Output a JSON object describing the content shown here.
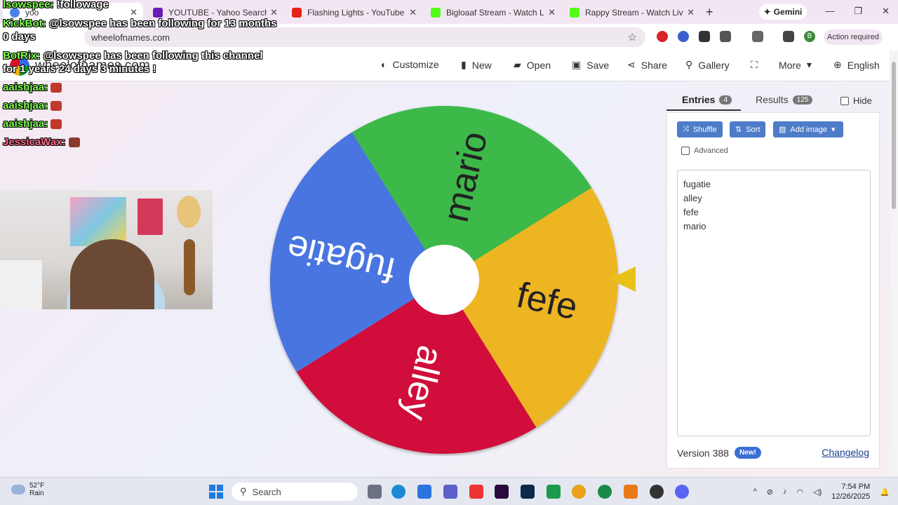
{
  "browser": {
    "tabs": [
      {
        "title": "yoo",
        "active": true
      },
      {
        "title": "YOUTUBE - Yahoo Search Results"
      },
      {
        "title": "Flashing Lights - YouTube"
      },
      {
        "title": "Bigloaaf Stream - Watch Live on"
      },
      {
        "title": "Rappy Stream - Watch Live on"
      }
    ],
    "gemini_label": "Gemini",
    "url": "wheelofnames.com",
    "action_required": "Action required",
    "profile_initial": "B"
  },
  "site": {
    "name": "wheelofnames.com",
    "nav": [
      {
        "label": "Customize",
        "icon": "palette-icon"
      },
      {
        "label": "New",
        "icon": "new-file-icon"
      },
      {
        "label": "Open",
        "icon": "folder-open-icon"
      },
      {
        "label": "Save",
        "icon": "save-icon"
      },
      {
        "label": "Share",
        "icon": "share-icon"
      },
      {
        "label": "Gallery",
        "icon": "search-icon"
      },
      {
        "label": "More",
        "icon": "chevron-down-icon"
      },
      {
        "label": "English",
        "icon": "globe-icon"
      }
    ]
  },
  "stream_overlay": {
    "chat": [
      {
        "user": "lsowspee:",
        "text": "!followage"
      },
      {
        "user": "KickBot:",
        "text": "@lsowspee has been following for 13 months 0 days"
      },
      {
        "user": "BotRix:",
        "text": "@lsowspee has been following this channel for 1 years 24 days 3 minutes !"
      },
      {
        "user": "aaishjaa:",
        "text": ""
      },
      {
        "user": "aaishjaa:",
        "text": ""
      },
      {
        "user": "aaishjaa:",
        "text": ""
      },
      {
        "user": "JessicaWax:",
        "text": ""
      }
    ]
  },
  "wheel": {
    "segments": [
      {
        "label": "mario",
        "color": "#3cb94a"
      },
      {
        "label": "fefe",
        "color": "#eeb520"
      },
      {
        "label": "alley",
        "color": "#d0103a"
      },
      {
        "label": "fugatie",
        "color": "#4a74e0"
      }
    ],
    "pointer_color": "#e8c21a"
  },
  "panel": {
    "tabs": [
      {
        "label": "Entries",
        "count": "4",
        "active": true
      },
      {
        "label": "Results",
        "count": "125"
      }
    ],
    "hide_label": "Hide",
    "buttons": [
      {
        "label": "Shuffle",
        "icon": "shuffle-icon"
      },
      {
        "label": "Sort",
        "icon": "sort-icon"
      },
      {
        "label": "Add image",
        "icon": "image-icon"
      }
    ],
    "advanced_label": "Advanced",
    "entries": [
      "fugatie",
      "alley",
      "fefe",
      "mario"
    ],
    "version": "Version 388",
    "new_badge": "New!",
    "changelog": "Changelog"
  },
  "taskbar": {
    "weather_temp": "52°F",
    "weather_desc": "Rain",
    "search_placeholder": "Search",
    "time": "7:54 PM",
    "date": "12/26/2025"
  },
  "colors": {
    "accent_blue": "#4d7cc9",
    "badge_new": "#3b6fd4"
  }
}
